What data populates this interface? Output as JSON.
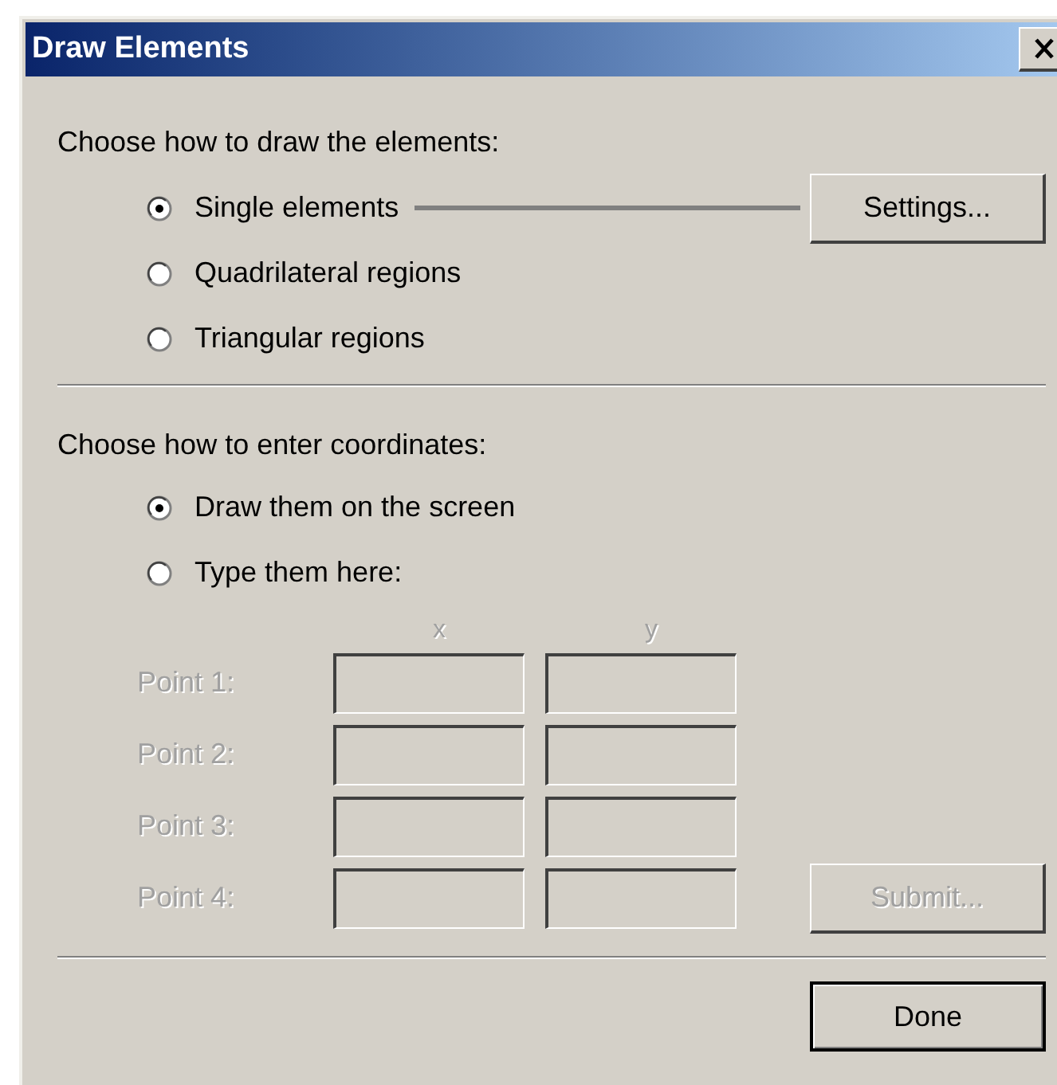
{
  "window": {
    "title": "Draw Elements"
  },
  "draw_section": {
    "prompt": "Choose how to draw the elements:",
    "options": [
      {
        "label": "Single elements",
        "selected": true
      },
      {
        "label": "Quadrilateral regions",
        "selected": false
      },
      {
        "label": "Triangular regions",
        "selected": false
      }
    ],
    "settings_button": {
      "label": "Settings...",
      "disabled": false
    }
  },
  "coordinates_section": {
    "prompt": "Choose how to enter coordinates:",
    "options": [
      {
        "label": "Draw them on the screen",
        "selected": true
      },
      {
        "label": "Type them here:",
        "selected": false
      }
    ],
    "inputs_disabled": true,
    "columns": [
      "x",
      "y"
    ],
    "points": [
      {
        "label": "Point 1:"
      },
      {
        "label": "Point 2:"
      },
      {
        "label": "Point 3:"
      },
      {
        "label": "Point 4:"
      }
    ],
    "submit_button": {
      "label": "Submit...",
      "disabled": true
    }
  },
  "done_button": {
    "label": "Done",
    "default": true
  }
}
